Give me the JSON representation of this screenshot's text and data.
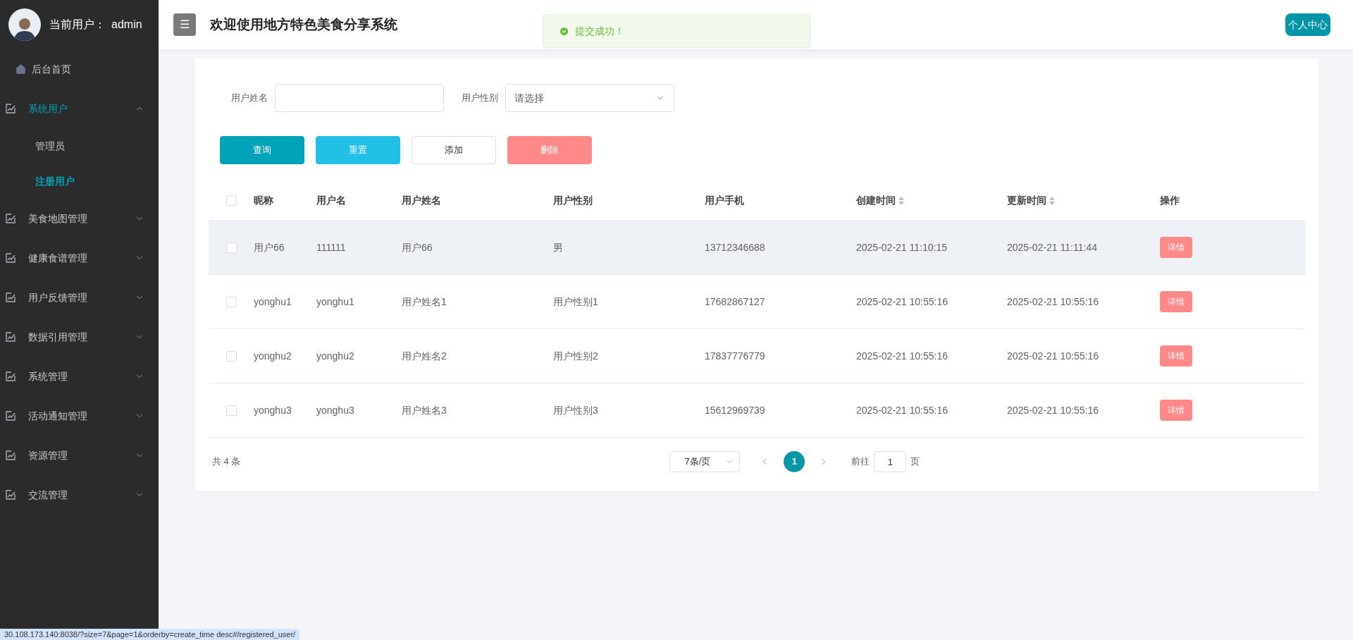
{
  "sidebar": {
    "user_label": "当前用户：",
    "user_name": "admin",
    "items": [
      {
        "kind": "home",
        "label": "后台首页"
      },
      {
        "kind": "group",
        "label": "系统用户",
        "expanded": true,
        "children": [
          {
            "label": "管理员",
            "selected": false
          },
          {
            "label": "注册用户",
            "selected": true
          }
        ]
      },
      {
        "kind": "group",
        "label": "美食地图管理",
        "expanded": false
      },
      {
        "kind": "group",
        "label": "健康食谱管理",
        "expanded": false
      },
      {
        "kind": "group",
        "label": "用户反馈管理",
        "expanded": false
      },
      {
        "kind": "group",
        "label": "数据引用管理",
        "expanded": false
      },
      {
        "kind": "group",
        "label": "系统管理",
        "expanded": false
      },
      {
        "kind": "group",
        "label": "活动通知管理",
        "expanded": false
      },
      {
        "kind": "group",
        "label": "资源管理",
        "expanded": false
      },
      {
        "kind": "group",
        "label": "交流管理",
        "expanded": false
      }
    ]
  },
  "header": {
    "menu_icon": "☰",
    "title": "欢迎使用地方特色美食分享系统",
    "profile_button": "个人中心"
  },
  "toast": {
    "message": "提交成功！"
  },
  "filters": [
    {
      "kind": "input",
      "label": "用户姓名"
    },
    {
      "kind": "select",
      "label": "用户性别",
      "placeholder": "请选择"
    }
  ],
  "buttons": [
    {
      "kind": "primary",
      "label": "查询"
    },
    {
      "kind": "info",
      "label": "重置"
    },
    {
      "kind": "plain",
      "label": "添加"
    },
    {
      "kind": "danger",
      "label": "删除"
    }
  ],
  "table": {
    "select_all": false,
    "columns": [
      {
        "label": "昵称",
        "sortable": false
      },
      {
        "label": "用户名",
        "sortable": false
      },
      {
        "label": "用户姓名",
        "sortable": false
      },
      {
        "label": "用户性别",
        "sortable": false
      },
      {
        "label": "用户手机",
        "sortable": false
      },
      {
        "label": "创建时间",
        "sortable": true
      },
      {
        "label": "更新时间",
        "sortable": true
      },
      {
        "label": "操作",
        "sortable": false
      }
    ],
    "rows": [
      {
        "highlighted": true,
        "checked": false,
        "cells": [
          "用户66",
          "111111",
          "用户66",
          "男",
          "13712346688",
          "2025-02-21 11:10:15",
          "2025-02-21 11:11:44"
        ],
        "action": "详情"
      },
      {
        "highlighted": false,
        "checked": false,
        "cells": [
          "yonghu1",
          "yonghu1",
          "用户姓名1",
          "用户性别1",
          "17682867127",
          "2025-02-21 10:55:16",
          "2025-02-21 10:55:16"
        ],
        "action": "详情"
      },
      {
        "highlighted": false,
        "checked": false,
        "cells": [
          "yonghu2",
          "yonghu2",
          "用户姓名2",
          "用户性别2",
          "17837776779",
          "2025-02-21 10:55:16",
          "2025-02-21 10:55:16"
        ],
        "action": "详情"
      },
      {
        "highlighted": false,
        "checked": false,
        "cells": [
          "yonghu3",
          "yonghu3",
          "用户姓名3",
          "用户性别3",
          "15612969739",
          "2025-02-21 10:55:16",
          "2025-02-21 10:55:16"
        ],
        "action": "详情"
      }
    ]
  },
  "pagination": {
    "total": "共 4 条",
    "page_size": "7条/页",
    "pages": [
      {
        "label": "1",
        "selected": true
      }
    ],
    "goto_label": "前往",
    "goto_value": "1",
    "goto_suffix": "页"
  },
  "status_bar": {
    "url": "30.108.173.140:8038/?size=7&page=1&orderby=create_time desc#/registered_user/"
  }
}
